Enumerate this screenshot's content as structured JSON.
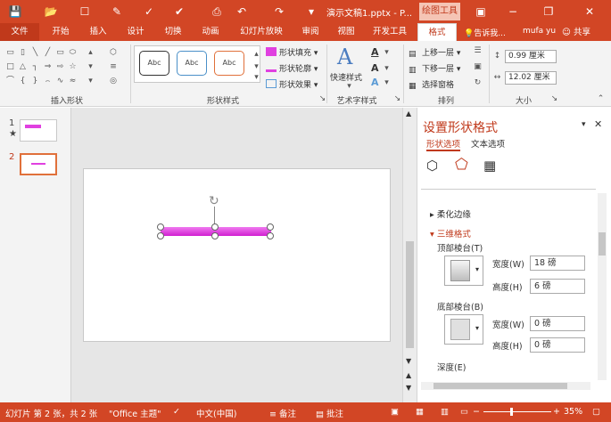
{
  "titlebar": {
    "title": "演示文稿1.pptx - P...",
    "context_tab_title": "绘图工具",
    "quick_access": [
      "save-icon",
      "open-folder-icon",
      "new-file-icon",
      "format-painter-icon",
      "redo-icon",
      "undo-icon"
    ]
  },
  "tabs": [
    "文件",
    "开始",
    "插入",
    "设计",
    "切换",
    "动画",
    "幻灯片放映",
    "审阅",
    "视图",
    "开发工具",
    "格式"
  ],
  "tell_me": "告诉我...",
  "user": "mufa yu",
  "share": "共享",
  "ribbon": {
    "insert_shapes_label": "插入形状",
    "shape_styles_label": "形状样式",
    "shape_style_swatch": "Abc",
    "shape_fill": "形状填充",
    "shape_outline": "形状轮廓",
    "shape_effects": "形状效果",
    "quick_styles": "快速样式",
    "wordart_label": "艺术字样式",
    "bring_forward": "上移一层",
    "send_backward": "下移一层",
    "selection_pane": "选择窗格",
    "arrange_label": "排列",
    "height": "0.99 厘米",
    "width": "12.02 厘米",
    "size_label": "大小"
  },
  "thumbnails": [
    {
      "number": "1",
      "marker": "★"
    },
    {
      "number": "2",
      "marker": ""
    }
  ],
  "taskpane": {
    "title": "设置形状格式",
    "tab_shape": "形状选项",
    "tab_text": "文本选项",
    "soft_edges": "柔化边缘",
    "three_d_format": "三维格式",
    "top_bevel": "顶部棱台(T)",
    "bottom_bevel": "底部棱台(B)",
    "width_label": "宽度(W)",
    "height_label": "高度(H)",
    "top_width": "18 磅",
    "top_height": "6 磅",
    "bottom_width": "0 磅",
    "bottom_height": "0 磅",
    "depth": "深度(E)"
  },
  "status": {
    "slide_info": "幻灯片 第 2 张，共 2 张",
    "theme": "\"Office 主题\"",
    "language": "中文(中国)",
    "notes": "备注",
    "comments": "批注",
    "zoom": "35%"
  },
  "colors": {
    "accent": "#d24625",
    "shape_fill": "#e040e0"
  }
}
